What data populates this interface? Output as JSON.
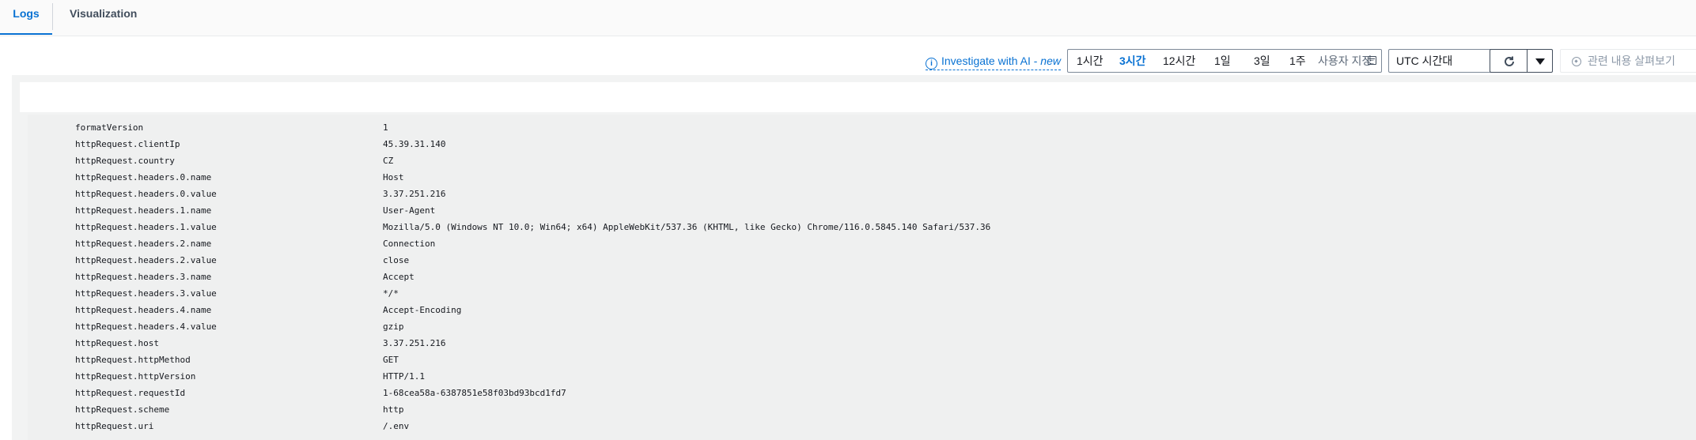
{
  "tabs": {
    "logs": "Logs",
    "visualization": "Visualization"
  },
  "toolbar": {
    "ai_icon": "i",
    "ai_link": "Investigate with AI - ",
    "ai_new": "new",
    "ranges": [
      "1시간",
      "3시간",
      "12시간",
      "1일",
      "3일",
      "1주"
    ],
    "active_range": "3시간",
    "custom": "사용자 지정",
    "timezone": "UTC 시간대",
    "explore": "관련 내용 살펴보기"
  },
  "icons": {
    "ai": "info-icon",
    "custom": "calendar-icon",
    "timezone": "caret-down-icon",
    "refresh": "refresh-icon",
    "refresh_menu": "caret-down-icon",
    "explore": "compass-icon"
  },
  "colors": {
    "accent": "#0972d3",
    "panel_bg": "#eff0f0",
    "text": "#16191f"
  },
  "log_fields": [
    {
      "key": "formatVersion",
      "value": "1"
    },
    {
      "key": "httpRequest.clientIp",
      "value": "45.39.31.140"
    },
    {
      "key": "httpRequest.country",
      "value": "CZ"
    },
    {
      "key": "httpRequest.headers.0.name",
      "value": "Host"
    },
    {
      "key": "httpRequest.headers.0.value",
      "value": "3.37.251.216"
    },
    {
      "key": "httpRequest.headers.1.name",
      "value": "User-Agent"
    },
    {
      "key": "httpRequest.headers.1.value",
      "value": "Mozilla/5.0 (Windows NT 10.0; Win64; x64) AppleWebKit/537.36 (KHTML, like Gecko) Chrome/116.0.5845.140 Safari/537.36"
    },
    {
      "key": "httpRequest.headers.2.name",
      "value": "Connection"
    },
    {
      "key": "httpRequest.headers.2.value",
      "value": "close"
    },
    {
      "key": "httpRequest.headers.3.name",
      "value": "Accept"
    },
    {
      "key": "httpRequest.headers.3.value",
      "value": "*/*"
    },
    {
      "key": "httpRequest.headers.4.name",
      "value": "Accept-Encoding"
    },
    {
      "key": "httpRequest.headers.4.value",
      "value": "gzip"
    },
    {
      "key": "httpRequest.host",
      "value": "3.37.251.216"
    },
    {
      "key": "httpRequest.httpMethod",
      "value": "GET"
    },
    {
      "key": "httpRequest.httpVersion",
      "value": "HTTP/1.1"
    },
    {
      "key": "httpRequest.requestId",
      "value": "1-68cea58a-6387851e58f03bd93bcd1fd7"
    },
    {
      "key": "httpRequest.scheme",
      "value": "http"
    },
    {
      "key": "httpRequest.uri",
      "value": "/.env"
    }
  ]
}
